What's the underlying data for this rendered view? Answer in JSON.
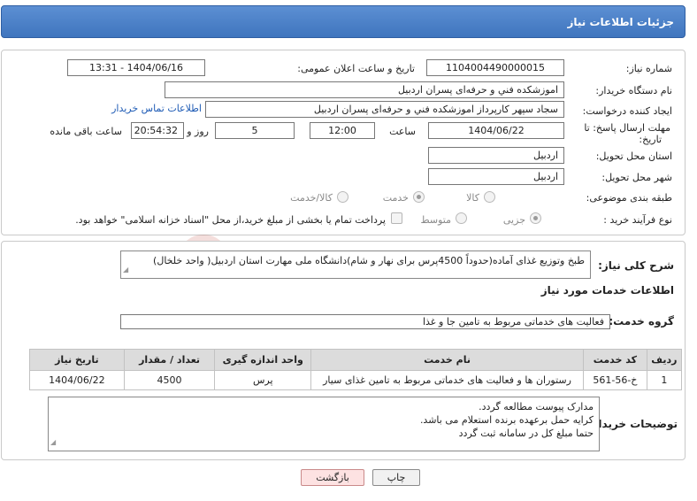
{
  "header": {
    "title": "جزئیات اطلاعات نیاز"
  },
  "form": {
    "need_number_label": "شماره نیاز:",
    "need_number": "1104004490000015",
    "announce_label": "تاریخ و ساعت اعلان عمومی:",
    "announce_value": "1404/06/16 - 13:31",
    "buyer_org_label": "نام دستگاه خریدار:",
    "buyer_org": "اموزشکده فني و حرفه‌ای پسران اردبیل",
    "requester_label": "ایجاد کننده درخواست:",
    "requester": "سجاد سپهر کارپرداز اموزشکده فني و حرفه‌ای پسران اردبیل",
    "buyer_contact_link": "اطلاعات تماس خریدار",
    "deadline_label_1": "مهلت ارسال پاسخ: تا",
    "deadline_label_2": "تاریخ:",
    "deadline_date": "1404/06/22",
    "time_label": "ساعت",
    "deadline_time": "12:00",
    "days_value": "5",
    "days_label": "روز و",
    "remaining_time": "20:54:32",
    "remaining_label": "ساعت باقی مانده",
    "province_label": "استان محل تحویل:",
    "province": "اردبیل",
    "city_label": "شهر محل تحویل:",
    "city": "اردبیل",
    "category_label": "طبقه بندی موضوعی:",
    "category_options": [
      "کالا",
      "خدمت",
      "کالا/خدمت"
    ],
    "category_selected": "خدمت",
    "process_label": "نوع فرآیند خرید :",
    "process_options": [
      "جزیی",
      "متوسط"
    ],
    "process_selected": "جزیی",
    "treasury_note": "پرداخت تمام یا بخشی از مبلغ خرید،از محل \"اسناد خزانه اسلامی\" خواهد بود."
  },
  "summary": {
    "label": "شرح کلی نیاز:",
    "text": "طبخ وتوزیع غذای آماده(حدوداً  4500پرس برای نهار و شام)دانشگاه ملی مهارت استان اردبیل( واحد خلخال)"
  },
  "services": {
    "section_title": "اطلاعات خدمات مورد نیاز",
    "group_label": "گروه خدمت:",
    "group_value": "فعالیت های خدماتی مربوط به تامین جا و غذا",
    "table": {
      "headers": [
        "ردیف",
        "کد خدمت",
        "نام خدمت",
        "واحد اندازه گیری",
        "تعداد / مقدار",
        "تاریخ نیاز"
      ],
      "rows": [
        [
          "1",
          "خ-56-561",
          "رستوران ها و فعالیت های خدماتی مربوط به تامین غذای سیار",
          "پرس",
          "4500",
          "1404/06/22"
        ]
      ]
    }
  },
  "buyer_notes": {
    "label": "توضیحات خریدار:",
    "lines": [
      "مدارک پیوست مطالعه گردد.",
      "کرایه حمل برعهده برنده استعلام می باشد.",
      "حتما مبلغ کل در سامانه ثبت گردد"
    ]
  },
  "buttons": {
    "print": "چاپ",
    "back": "بازگشت"
  },
  "watermark_text": "AriaTender.neT",
  "colors": {
    "header": "#3f75be",
    "link": "#1e5bb5",
    "back_button": "#fde2e2"
  }
}
